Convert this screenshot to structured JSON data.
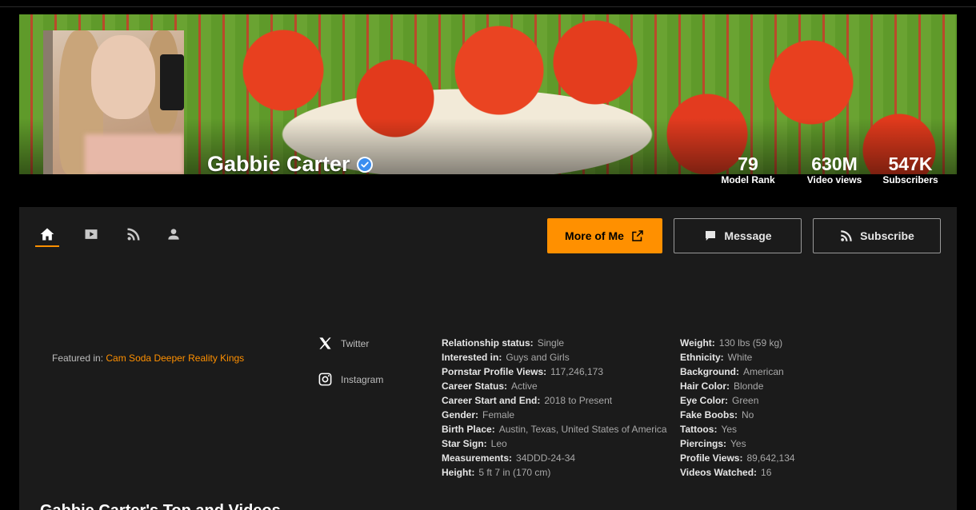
{
  "profile": {
    "name": "Gabbie Carter"
  },
  "stats": [
    {
      "value": "79",
      "label": "Model Rank"
    },
    {
      "value": "630M",
      "label": "Video views"
    },
    {
      "value": "547K",
      "label": "Subscribers"
    }
  ],
  "nav": {
    "items": [
      "home-icon",
      "video-icon",
      "feed-icon",
      "user-icon"
    ],
    "active": "home-icon"
  },
  "actions": {
    "more_label": "More of Me",
    "message_label": "Message",
    "subscribe_label": "Subscribe"
  },
  "featured": {
    "prefix": "Featured in:",
    "links": [
      "Cam Soda",
      "Deeper",
      "Reality Kings"
    ]
  },
  "social": {
    "twitter_label": "Twitter",
    "instagram_label": "Instagram"
  },
  "info_col1": [
    {
      "k": "Relationship status:",
      "v": "Single"
    },
    {
      "k": "Interested in:",
      "v": "Guys and Girls"
    },
    {
      "k": "Pornstar Profile Views:",
      "v": "117,246,173"
    },
    {
      "k": "Career Status:",
      "v": "Active"
    },
    {
      "k": "Career Start and End:",
      "v": "2018 to Present"
    },
    {
      "k": "Gender:",
      "v": "Female"
    },
    {
      "k": "Birth Place:",
      "v": "Austin, Texas, United States of America"
    },
    {
      "k": "Star Sign:",
      "v": "Leo"
    },
    {
      "k": "Measurements:",
      "v": "34DDD-24-34"
    },
    {
      "k": "Height:",
      "v": "5 ft 7 in (170 cm)"
    }
  ],
  "info_col2": [
    {
      "k": "Weight:",
      "v": "130 lbs (59 kg)"
    },
    {
      "k": "Ethnicity:",
      "v": "White"
    },
    {
      "k": "Background:",
      "v": "American"
    },
    {
      "k": "Hair Color:",
      "v": "Blonde"
    },
    {
      "k": "Eye Color:",
      "v": "Green"
    },
    {
      "k": "Fake Boobs:",
      "v": "No"
    },
    {
      "k": "Tattoos:",
      "v": "Yes"
    },
    {
      "k": "Piercings:",
      "v": "Yes"
    },
    {
      "k": "Profile Views:",
      "v": "89,642,134"
    },
    {
      "k": "Videos Watched:",
      "v": "16"
    }
  ],
  "section": {
    "title": "Gabbie Carter's Top and Videos"
  },
  "colors": {
    "accent": "#ff9000",
    "verified": "#3b8ef0",
    "panel": "#1b1b1b"
  }
}
